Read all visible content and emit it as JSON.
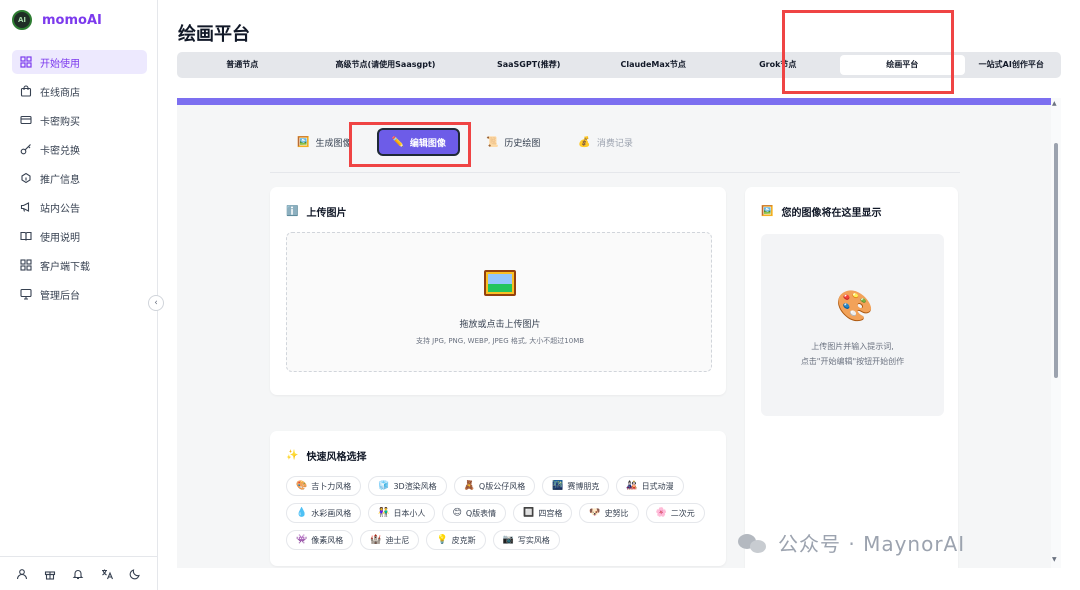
{
  "brand": {
    "name": "momoAI",
    "logo_text": "AI"
  },
  "sidebar": {
    "items": [
      {
        "label": "开始使用",
        "icon": "grid-icon",
        "active": true
      },
      {
        "label": "在线商店",
        "icon": "shopping-bag-icon",
        "active": false
      },
      {
        "label": "卡密购买",
        "icon": "credit-card-icon",
        "active": false
      },
      {
        "label": "卡密兑换",
        "icon": "key-icon",
        "active": false
      },
      {
        "label": "推广信息",
        "icon": "share-icon",
        "active": false
      },
      {
        "label": "站内公告",
        "icon": "megaphone-icon",
        "active": false
      },
      {
        "label": "使用说明",
        "icon": "book-icon",
        "active": false
      },
      {
        "label": "客户端下载",
        "icon": "download-grid-icon",
        "active": false
      },
      {
        "label": "管理后台",
        "icon": "monitor-icon",
        "active": false
      }
    ],
    "collapse_glyph": "‹",
    "footer_icons": [
      "user-icon",
      "gift-icon",
      "bell-icon",
      "translate-icon",
      "moon-icon"
    ]
  },
  "main": {
    "title": "绘画平台",
    "top_tabs": [
      {
        "label": "普通节点",
        "active": false
      },
      {
        "label": "高级节点(请使用Saasgpt)",
        "active": false
      },
      {
        "label": "SaaSGPT(推荐)",
        "active": false
      },
      {
        "label": "ClaudeMax节点",
        "active": false
      },
      {
        "label": "Grok节点",
        "active": false
      },
      {
        "label": "绘画平台",
        "active": true
      },
      {
        "label": "一站式AI创作平台",
        "active": false
      }
    ],
    "sub_tabs": [
      {
        "label": "生成图像",
        "icon": "🖼️",
        "state": "normal"
      },
      {
        "label": "编辑图像",
        "icon": "✏️",
        "state": "active"
      },
      {
        "label": "历史绘图",
        "icon": "📜",
        "state": "normal"
      },
      {
        "label": "消费记录",
        "icon": "💰",
        "state": "disabled"
      }
    ],
    "upload": {
      "title": "上传图片",
      "title_icon": "ℹ️",
      "drop_text": "拖放或点击上传图片",
      "drop_hint": "支持 JPG, PNG, WEBP, JPEG 格式, 大小不超过10MB"
    },
    "styles": {
      "title": "快速风格选择",
      "title_icon": "✨",
      "chips": [
        {
          "label": "吉卜力风格",
          "icon": "🎨"
        },
        {
          "label": "3D渲染风格",
          "icon": "🧊"
        },
        {
          "label": "Q版公仔风格",
          "icon": "🧸"
        },
        {
          "label": "赛博朋克",
          "icon": "🌃"
        },
        {
          "label": "日式动漫",
          "icon": "🎎"
        },
        {
          "label": "水彩画风格",
          "icon": "💧"
        },
        {
          "label": "日本小人",
          "icon": "👫"
        },
        {
          "label": "Q版表情",
          "icon": "😊"
        },
        {
          "label": "四宫格",
          "icon": "🔲"
        },
        {
          "label": "史努比",
          "icon": "🐶"
        },
        {
          "label": "二次元",
          "icon": "🌸"
        },
        {
          "label": "像素风格",
          "icon": "👾"
        },
        {
          "label": "迪士尼",
          "icon": "🏰"
        },
        {
          "label": "皮克斯",
          "icon": "💡"
        },
        {
          "label": "写实风格",
          "icon": "📷"
        }
      ]
    },
    "result": {
      "title": "您的图像将在这里显示",
      "title_icon": "🖼️",
      "placeholder_icon": "🎨",
      "line1": "上传图片并输入提示词,",
      "line2": "点击\"开始编辑\"按钮开始创作"
    }
  },
  "watermark": {
    "text": "公众号 · MaynorAI"
  },
  "colors": {
    "accent": "#7c3aed",
    "active_tab": "#6d5ce8",
    "highlight": "#ef4444",
    "bar": "#7c6ff0"
  }
}
